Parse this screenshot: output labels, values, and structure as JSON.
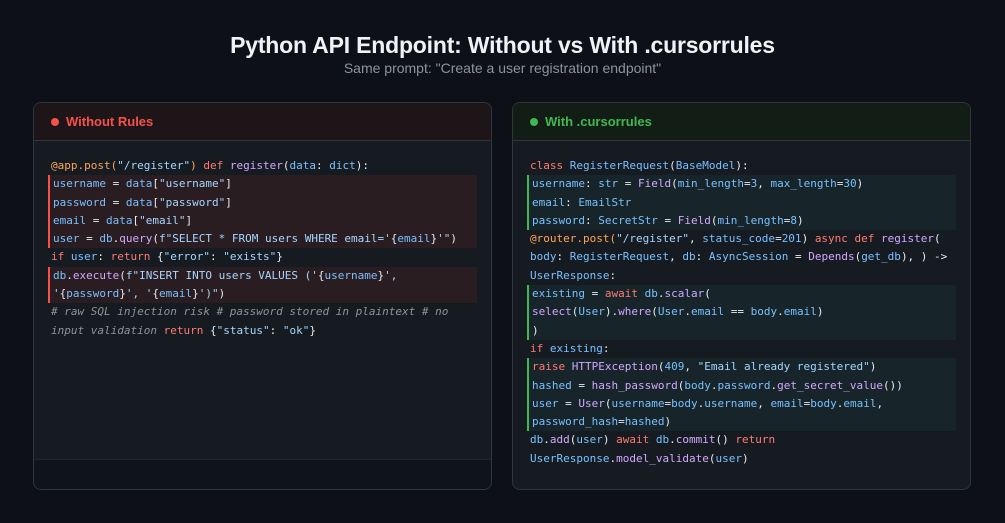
{
  "header": {
    "title": "Python API Endpoint: Without vs With .cursorrules",
    "subtitle": "Same prompt: \"Create a user registration endpoint\""
  },
  "colors": {
    "bad_accent": "#f85149",
    "good_accent": "#3fb950",
    "background": "#0d1117"
  },
  "left_panel": {
    "label": "Without Rules",
    "lines": [
      {
        "hl": false,
        "tokens": [
          [
            "dec",
            "@app.post("
          ],
          [
            "str",
            "\"/register\""
          ],
          [
            "dec",
            ")"
          ],
          [
            "pl",
            " "
          ],
          [
            "kw",
            "def"
          ],
          [
            "pl",
            " "
          ],
          [
            "fn",
            "register"
          ],
          [
            "pl",
            "("
          ],
          [
            "var",
            "data"
          ],
          [
            "pl",
            ": "
          ],
          [
            "cls",
            "dict"
          ],
          [
            "pl",
            "):"
          ]
        ]
      },
      {
        "hl": true,
        "tokens": [
          [
            "var",
            "username"
          ],
          [
            "pl",
            " = "
          ],
          [
            "var",
            "data"
          ],
          [
            "pl",
            "["
          ],
          [
            "str",
            "\"username\""
          ],
          [
            "pl",
            "]"
          ]
        ]
      },
      {
        "hl": true,
        "tokens": [
          [
            "var",
            "password"
          ],
          [
            "pl",
            " = "
          ],
          [
            "var",
            "data"
          ],
          [
            "pl",
            "["
          ],
          [
            "str",
            "\"password\""
          ],
          [
            "pl",
            "]"
          ]
        ]
      },
      {
        "hl": true,
        "tokens": [
          [
            "var",
            "email"
          ],
          [
            "pl",
            " = "
          ],
          [
            "var",
            "data"
          ],
          [
            "pl",
            "["
          ],
          [
            "str",
            "\"email\""
          ],
          [
            "pl",
            "]"
          ]
        ]
      },
      {
        "hl": true,
        "tokens": [
          [
            "var",
            "user"
          ],
          [
            "pl",
            " = "
          ],
          [
            "var",
            "db"
          ],
          [
            "pl",
            "."
          ],
          [
            "fn",
            "query"
          ],
          [
            "pl",
            "("
          ],
          [
            "str",
            "f\"SELECT * FROM users WHERE email='"
          ],
          [
            "pl",
            "{"
          ],
          [
            "var",
            "email"
          ],
          [
            "pl",
            "}"
          ],
          [
            "str",
            "'\""
          ],
          [
            "pl",
            ")"
          ]
        ]
      },
      {
        "hl": false,
        "tokens": [
          [
            "kw",
            "if"
          ],
          [
            "pl",
            " "
          ],
          [
            "var",
            "user"
          ],
          [
            "pl",
            ": "
          ],
          [
            "kw",
            "return"
          ],
          [
            "pl",
            " {"
          ],
          [
            "str",
            "\"error\""
          ],
          [
            "pl",
            ": "
          ],
          [
            "str",
            "\"exists\""
          ],
          [
            "pl",
            "}"
          ]
        ]
      },
      {
        "hl": true,
        "tokens": [
          [
            "var",
            "db"
          ],
          [
            "pl",
            "."
          ],
          [
            "fn",
            "execute"
          ],
          [
            "pl",
            "("
          ],
          [
            "str",
            "f\"INSERT INTO users VALUES ('"
          ],
          [
            "pl",
            "{"
          ],
          [
            "var",
            "username"
          ],
          [
            "pl",
            "}"
          ],
          [
            "str",
            "',"
          ]
        ]
      },
      {
        "hl": true,
        "tokens": [
          [
            "str",
            "'"
          ],
          [
            "pl",
            "{"
          ],
          [
            "var",
            "password"
          ],
          [
            "pl",
            "}"
          ],
          [
            "str",
            "', '"
          ],
          [
            "pl",
            "{"
          ],
          [
            "var",
            "email"
          ],
          [
            "pl",
            "}"
          ],
          [
            "str",
            "')\""
          ],
          [
            "pl",
            ")"
          ]
        ]
      },
      {
        "hl": false,
        "tokens": [
          [
            "cmt",
            "# raw SQL injection risk # password stored in plaintext # no"
          ]
        ]
      },
      {
        "hl": false,
        "tokens": [
          [
            "cmt",
            "input validation "
          ],
          [
            "kw",
            "return"
          ],
          [
            "pl",
            " {"
          ],
          [
            "str",
            "\"status\""
          ],
          [
            "pl",
            ": "
          ],
          [
            "str",
            "\"ok\""
          ],
          [
            "pl",
            "}"
          ]
        ]
      }
    ]
  },
  "right_panel": {
    "label": "With .cursorrules",
    "lines": [
      {
        "hl": false,
        "tokens": [
          [
            "kw",
            "class"
          ],
          [
            "pl",
            " "
          ],
          [
            "cls",
            "RegisterRequest"
          ],
          [
            "pl",
            "("
          ],
          [
            "cls",
            "BaseModel"
          ],
          [
            "pl",
            "):"
          ]
        ]
      },
      {
        "hl": true,
        "tokens": [
          [
            "var",
            "username"
          ],
          [
            "pl",
            ": "
          ],
          [
            "cls",
            "str"
          ],
          [
            "pl",
            " = "
          ],
          [
            "fn",
            "Field"
          ],
          [
            "pl",
            "("
          ],
          [
            "var",
            "min_length"
          ],
          [
            "pl",
            "="
          ],
          [
            "num",
            "3"
          ],
          [
            "pl",
            ", "
          ],
          [
            "var",
            "max_length"
          ],
          [
            "pl",
            "="
          ],
          [
            "num",
            "30"
          ],
          [
            "pl",
            ")"
          ]
        ]
      },
      {
        "hl": true,
        "tokens": [
          [
            "var",
            "email"
          ],
          [
            "pl",
            ": "
          ],
          [
            "cls",
            "EmailStr"
          ]
        ]
      },
      {
        "hl": true,
        "tokens": [
          [
            "var",
            "password"
          ],
          [
            "pl",
            ": "
          ],
          [
            "cls",
            "SecretStr"
          ],
          [
            "pl",
            " = "
          ],
          [
            "fn",
            "Field"
          ],
          [
            "pl",
            "("
          ],
          [
            "var",
            "min_length"
          ],
          [
            "pl",
            "="
          ],
          [
            "num",
            "8"
          ],
          [
            "pl",
            ")"
          ]
        ]
      },
      {
        "hl": false,
        "tokens": [
          [
            "dec",
            "@router.post("
          ],
          [
            "str",
            "\"/register\""
          ],
          [
            "pl",
            ", "
          ],
          [
            "var",
            "status_code"
          ],
          [
            "pl",
            "="
          ],
          [
            "num",
            "201"
          ],
          [
            "pl",
            ") "
          ],
          [
            "kw",
            "async def"
          ],
          [
            "pl",
            " "
          ],
          [
            "fn",
            "register"
          ],
          [
            "pl",
            "("
          ]
        ]
      },
      {
        "hl": false,
        "tokens": [
          [
            "var",
            "body"
          ],
          [
            "pl",
            ": "
          ],
          [
            "cls",
            "RegisterRequest"
          ],
          [
            "pl",
            ", "
          ],
          [
            "var",
            "db"
          ],
          [
            "pl",
            ": "
          ],
          [
            "cls",
            "AsyncSession"
          ],
          [
            "pl",
            " = "
          ],
          [
            "fn",
            "Depends"
          ],
          [
            "pl",
            "("
          ],
          [
            "var",
            "get_db"
          ],
          [
            "pl",
            "), ) ->"
          ]
        ]
      },
      {
        "hl": false,
        "tokens": [
          [
            "cls",
            "UserResponse"
          ],
          [
            "pl",
            ":"
          ]
        ]
      },
      {
        "hl": true,
        "tokens": [
          [
            "var",
            "existing"
          ],
          [
            "pl",
            " = "
          ],
          [
            "kw",
            "await"
          ],
          [
            "pl",
            " "
          ],
          [
            "var",
            "db"
          ],
          [
            "pl",
            "."
          ],
          [
            "fn",
            "scalar"
          ],
          [
            "pl",
            "("
          ]
        ]
      },
      {
        "hl": true,
        "tokens": [
          [
            "fn",
            "select"
          ],
          [
            "pl",
            "("
          ],
          [
            "cls",
            "User"
          ],
          [
            "pl",
            ")."
          ],
          [
            "fn",
            "where"
          ],
          [
            "pl",
            "("
          ],
          [
            "cls",
            "User"
          ],
          [
            "pl",
            "."
          ],
          [
            "var",
            "email"
          ],
          [
            "pl",
            " == "
          ],
          [
            "var",
            "body"
          ],
          [
            "pl",
            "."
          ],
          [
            "var",
            "email"
          ],
          [
            "pl",
            ")"
          ]
        ]
      },
      {
        "hl": true,
        "tokens": [
          [
            "pl",
            ")"
          ]
        ]
      },
      {
        "hl": false,
        "tokens": [
          [
            "kw",
            "if"
          ],
          [
            "pl",
            " "
          ],
          [
            "var",
            "existing"
          ],
          [
            "pl",
            ":"
          ]
        ]
      },
      {
        "hl": true,
        "tokens": [
          [
            "kw",
            "raise"
          ],
          [
            "pl",
            " "
          ],
          [
            "fn",
            "HTTPException"
          ],
          [
            "pl",
            "("
          ],
          [
            "num",
            "409"
          ],
          [
            "pl",
            ", "
          ],
          [
            "str",
            "\"Email already registered\""
          ],
          [
            "pl",
            ")"
          ]
        ]
      },
      {
        "hl": true,
        "tokens": [
          [
            "var",
            "hashed"
          ],
          [
            "pl",
            " = "
          ],
          [
            "fn",
            "hash_password"
          ],
          [
            "pl",
            "("
          ],
          [
            "var",
            "body"
          ],
          [
            "pl",
            "."
          ],
          [
            "var",
            "password"
          ],
          [
            "pl",
            "."
          ],
          [
            "fn",
            "get_secret_value"
          ],
          [
            "pl",
            "())"
          ]
        ]
      },
      {
        "hl": true,
        "tokens": [
          [
            "var",
            "user"
          ],
          [
            "pl",
            " = "
          ],
          [
            "fn",
            "User"
          ],
          [
            "pl",
            "("
          ],
          [
            "var",
            "username"
          ],
          [
            "pl",
            "="
          ],
          [
            "var",
            "body"
          ],
          [
            "pl",
            "."
          ],
          [
            "var",
            "username"
          ],
          [
            "pl",
            ", "
          ],
          [
            "var",
            "email"
          ],
          [
            "pl",
            "="
          ],
          [
            "var",
            "body"
          ],
          [
            "pl",
            "."
          ],
          [
            "var",
            "email"
          ],
          [
            "pl",
            ","
          ]
        ]
      },
      {
        "hl": true,
        "tokens": [
          [
            "var",
            "password_hash"
          ],
          [
            "pl",
            "="
          ],
          [
            "var",
            "hashed"
          ],
          [
            "pl",
            ")"
          ]
        ]
      },
      {
        "hl": false,
        "tokens": [
          [
            "var",
            "db"
          ],
          [
            "pl",
            "."
          ],
          [
            "fn",
            "add"
          ],
          [
            "pl",
            "("
          ],
          [
            "var",
            "user"
          ],
          [
            "pl",
            ") "
          ],
          [
            "kw",
            "await"
          ],
          [
            "pl",
            " "
          ],
          [
            "var",
            "db"
          ],
          [
            "pl",
            "."
          ],
          [
            "fn",
            "commit"
          ],
          [
            "pl",
            "() "
          ],
          [
            "kw",
            "return"
          ]
        ]
      },
      {
        "hl": false,
        "tokens": [
          [
            "cls",
            "UserResponse"
          ],
          [
            "pl",
            "."
          ],
          [
            "fn",
            "model_validate"
          ],
          [
            "pl",
            "("
          ],
          [
            "var",
            "user"
          ],
          [
            "pl",
            ")"
          ]
        ]
      }
    ]
  }
}
